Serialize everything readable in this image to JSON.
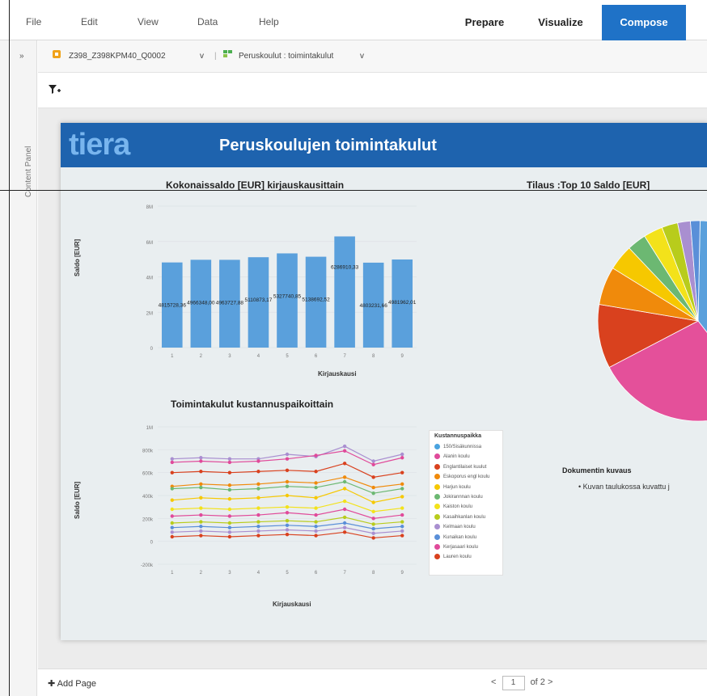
{
  "menu": {
    "file": "File",
    "edit": "Edit",
    "view": "View",
    "data": "Data",
    "help": "Help"
  },
  "modes": {
    "prepare": "Prepare",
    "visualize": "Visualize",
    "compose": "Compose"
  },
  "colors": {
    "accent": "#1f72c7",
    "header": "#1e63ae",
    "logo": "#78b5ee"
  },
  "left_panel": {
    "expand": "»",
    "label": "Content Panel"
  },
  "query_bar": {
    "source": "Z398_Z398KPM40_Q0002",
    "dropdown": "v",
    "separator": "|",
    "view": "Peruskoulut : toimintakulut",
    "dropdown2": "v"
  },
  "filter": {
    "icon": "filter-add-icon"
  },
  "report": {
    "logo": "tiera",
    "title": "Peruskoulujen toimintakulut",
    "description_title": "Dokumentin kuvaus",
    "description_item": "• Kuvan taulukossa kuvattu j"
  },
  "legend": {
    "title": "Kustannuspaikka",
    "items": [
      {
        "label": "150/Sisäkunnissa",
        "color": "#4aa3df"
      },
      {
        "label": "Alanin koulu",
        "color": "#e04a9a"
      },
      {
        "label": "Englantilaiset kuulut",
        "color": "#d9411e"
      },
      {
        "label": "Eskoporus engl koulu",
        "color": "#f08a0b"
      },
      {
        "label": "Harjun koulu",
        "color": "#f6c800"
      },
      {
        "label": "Jokirannnan koulu",
        "color": "#6cb872"
      },
      {
        "label": "Kaiston koulu",
        "color": "#f3e21a"
      },
      {
        "label": "Kasaihkanlan koulu",
        "color": "#b8cc1c"
      },
      {
        "label": "Kelmaan koulu",
        "color": "#a98fd0"
      },
      {
        "label": "Kunaikan koulu",
        "color": "#5a8fd8"
      },
      {
        "label": "Kerjasaari koulu",
        "color": "#e04a9a"
      },
      {
        "label": "Lauren koulu",
        "color": "#d9411e"
      }
    ]
  },
  "footer": {
    "add_page": "✚ Add Page",
    "prev": "<",
    "page": "1",
    "of": "of 2",
    "next": ">"
  },
  "chart_data": [
    {
      "type": "bar",
      "title": "Kokonaissaldo [EUR] kirjauskausittain",
      "xlabel": "Kirjauskausi",
      "ylabel": "Saldo [EUR]",
      "categories": [
        "1",
        "2",
        "3",
        "4",
        "5",
        "6",
        "7",
        "8",
        "9"
      ],
      "ylim": [
        0,
        8000000
      ],
      "yticks": [
        "0",
        "2M",
        "4M",
        "6M",
        "8M"
      ],
      "values": [
        4815728.36,
        4966348.0,
        4963727.88,
        5110873.17,
        5327740.85,
        5138692.52,
        6286910.33,
        4803231.66,
        4981962.01
      ],
      "data_labels": [
        "4815728,36",
        "4966348,00",
        "4963727,88",
        "5110873,17",
        "5327740,85",
        "5138692,52",
        "6286910,33",
        "4803231,66",
        "4981962,01"
      ],
      "color": "#5aa0dc"
    },
    {
      "type": "pie",
      "title": "Tilaus :Top 10 Saldo [EUR]",
      "slices": [
        {
          "value": 38,
          "color": "#5aa0dc"
        },
        {
          "value": 27,
          "color": "#e4509a"
        },
        {
          "value": 10,
          "color": "#d9411e"
        },
        {
          "value": 6,
          "color": "#f08a0b"
        },
        {
          "value": 4,
          "color": "#f6c800"
        },
        {
          "value": 3,
          "color": "#6cb872"
        },
        {
          "value": 3,
          "color": "#f3e21a"
        },
        {
          "value": 2.5,
          "color": "#b8cc1c"
        },
        {
          "value": 2,
          "color": "#a98fd0"
        },
        {
          "value": 1.5,
          "color": "#5a8fd8"
        }
      ]
    },
    {
      "type": "line",
      "title": "Toimintakulut kustannuspaikoittain",
      "xlabel": "Kirjauskausi",
      "ylabel": "Saldo [EUR]",
      "x": [
        "1",
        "2",
        "3",
        "4",
        "5",
        "6",
        "7",
        "8",
        "9"
      ],
      "ylim": [
        -200000,
        1000000
      ],
      "yticks": [
        "-200k",
        "0",
        "200k",
        "400k",
        "600k",
        "800k",
        "1M"
      ],
      "series": [
        {
          "name": "150/Sisäkunnissa",
          "color": "#a98fd0",
          "values": [
            720000,
            730000,
            720000,
            720000,
            760000,
            740000,
            830000,
            700000,
            760000
          ]
        },
        {
          "name": "Alanin koulu",
          "color": "#e04a9a",
          "values": [
            690000,
            700000,
            690000,
            700000,
            720000,
            750000,
            790000,
            670000,
            730000
          ]
        },
        {
          "name": "Englantilaiset kuulut",
          "color": "#d9411e",
          "values": [
            600000,
            610000,
            600000,
            610000,
            620000,
            610000,
            680000,
            560000,
            600000
          ]
        },
        {
          "name": "Eskoporus engl koulu",
          "color": "#f08a0b",
          "values": [
            480000,
            500000,
            490000,
            500000,
            520000,
            510000,
            560000,
            470000,
            500000
          ]
        },
        {
          "name": "Harjun koulu",
          "color": "#f6c800",
          "values": [
            360000,
            380000,
            370000,
            380000,
            400000,
            380000,
            460000,
            340000,
            390000
          ]
        },
        {
          "name": "Jokirannnan koulu",
          "color": "#6cb872",
          "values": [
            460000,
            470000,
            450000,
            460000,
            480000,
            470000,
            520000,
            420000,
            460000
          ]
        },
        {
          "name": "Kaiston koulu",
          "color": "#f3e21a",
          "values": [
            280000,
            290000,
            280000,
            290000,
            300000,
            290000,
            350000,
            260000,
            290000
          ]
        },
        {
          "name": "Kasaihkanlan koulu",
          "color": "#b8cc1c",
          "values": [
            160000,
            170000,
            160000,
            170000,
            180000,
            170000,
            210000,
            150000,
            170000
          ]
        },
        {
          "name": "Kelmaan koulu",
          "color": "#a98fd0",
          "values": [
            80000,
            90000,
            80000,
            90000,
            100000,
            90000,
            120000,
            70000,
            90000
          ]
        },
        {
          "name": "Kunaikan koulu",
          "color": "#5a8fd8",
          "values": [
            120000,
            130000,
            120000,
            130000,
            140000,
            130000,
            160000,
            110000,
            130000
          ]
        },
        {
          "name": "Kerjasaari koulu",
          "color": "#e04a9a",
          "values": [
            220000,
            230000,
            220000,
            230000,
            250000,
            230000,
            280000,
            200000,
            230000
          ]
        },
        {
          "name": "Lauren koulu",
          "color": "#d9411e",
          "values": [
            40000,
            50000,
            40000,
            50000,
            60000,
            50000,
            80000,
            30000,
            50000
          ]
        }
      ]
    }
  ]
}
